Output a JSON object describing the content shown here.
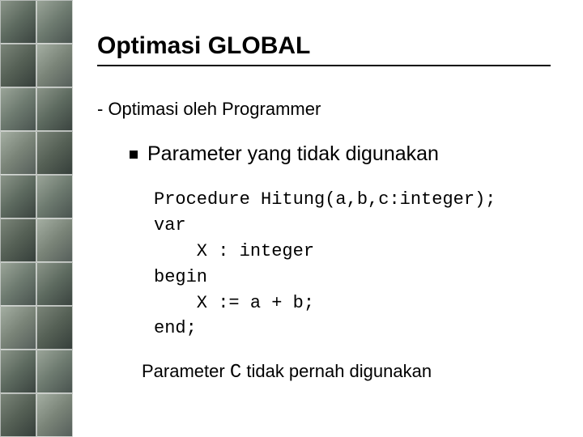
{
  "title": "Optimasi GLOBAL",
  "subheading": "- Optimasi oleh Programmer",
  "bullet": "Parameter yang tidak digunakan",
  "code": {
    "l1": "Procedure Hitung(a,b,c:integer);",
    "l2": "var",
    "l3": "    X : integer",
    "l4": "begin",
    "l5": "    X := a + b;",
    "l6": "end;"
  },
  "footnote_pre": "Parameter ",
  "footnote_code": "C",
  "footnote_post": " tidak pernah digunakan"
}
